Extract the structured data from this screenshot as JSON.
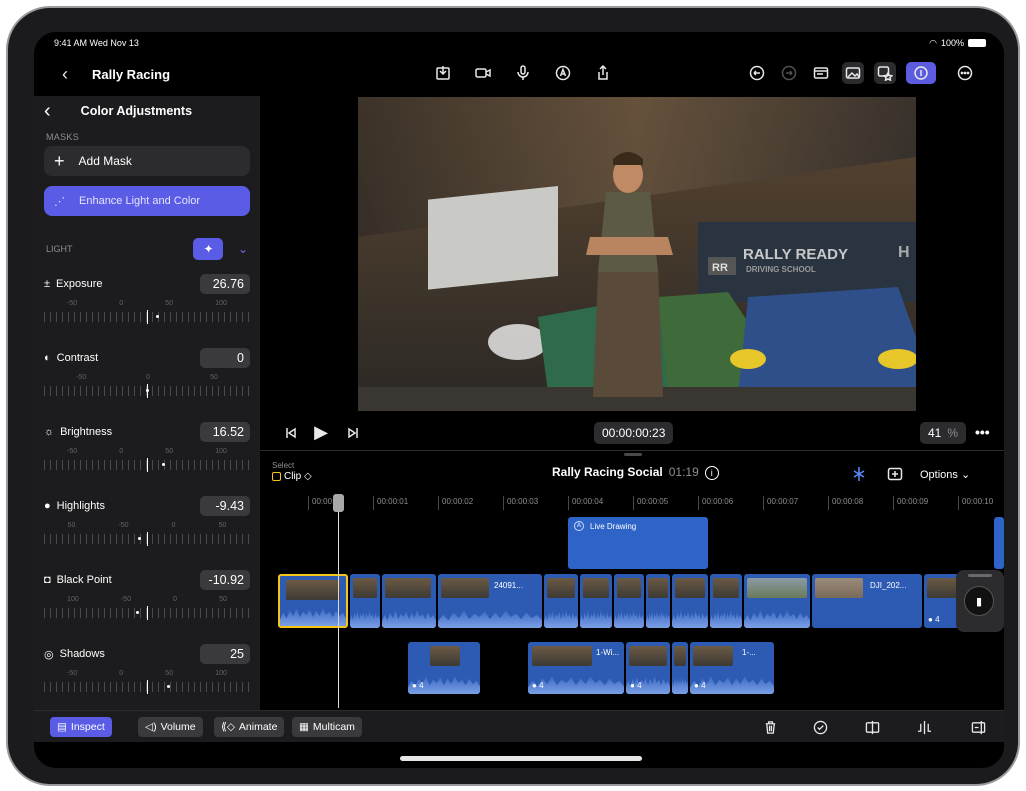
{
  "status": {
    "time_date": "9:41 AM  Wed Nov 13",
    "battery": "100%"
  },
  "topbar": {
    "back_label": "<",
    "title": "Rally Racing"
  },
  "inspector": {
    "title": "Color Adjustments",
    "masks_label": "MASKS",
    "add_mask_label": "Add Mask",
    "enhance_label": "Enhance Light and Color",
    "light_label": "LIGHT",
    "params": [
      {
        "name": "Exposure",
        "icon": "±",
        "value": "26.76",
        "ticks": [
          "-50",
          "0",
          "50",
          "100"
        ],
        "fraction": 0.55
      },
      {
        "name": "Contrast",
        "icon": "◐",
        "value": "0",
        "ticks": [
          "-50",
          "0",
          "50"
        ],
        "fraction": 0.5
      },
      {
        "name": "Brightness",
        "icon": "☼",
        "value": "16.52",
        "ticks": [
          "-50",
          "0",
          "50",
          "100"
        ],
        "fraction": 0.58
      },
      {
        "name": "Highlights",
        "icon": "●",
        "value": "-9.43",
        "ticks": [
          "50",
          "-50",
          "0",
          "50"
        ],
        "fraction": 0.46
      },
      {
        "name": "Black Point",
        "icon": "◘",
        "value": "-10.92",
        "ticks": [
          "100",
          "-50",
          "0",
          "50"
        ],
        "fraction": 0.45
      },
      {
        "name": "Shadows",
        "icon": "◎",
        "value": "25",
        "ticks": [
          "-50",
          "0",
          "50",
          "100"
        ],
        "fraction": 0.6
      }
    ]
  },
  "viewer": {
    "sign_text": "RALLY READY",
    "sign_subtext": "DRIVING SCHOOL",
    "sign_logo": "RR",
    "sign_letter": "H"
  },
  "player": {
    "timecode": "00:00:00:23",
    "zoom_value": "41",
    "zoom_unit": "%"
  },
  "timeline": {
    "select_label": "Select",
    "clip_mode": "Clip ◇",
    "project_name": "Rally Racing Social",
    "duration": "01:19",
    "options_label": "Options",
    "ruler": [
      "00:00:00",
      "00:00:01",
      "00:00:02",
      "00:00:03",
      "00:00:04",
      "00:00:05",
      "00:00:06",
      "00:00:07",
      "00:00:08",
      "00:00:09",
      "00:00:10",
      "00:0"
    ],
    "title_clip": "Live Drawing",
    "clip_24091": "24091...",
    "clip_dji": "DJI_202...",
    "conn_a_badge": "4",
    "conn_b_label": "1-Wi...",
    "conn_b_badge": "4",
    "conn_c_badge": "4",
    "conn_d_label": "1-...",
    "conn_d_badge": "4",
    "main_end_badge": "4"
  },
  "bottombar": {
    "inspect_label": "Inspect",
    "volume_label": "Volume",
    "animate_label": "Animate",
    "multicam_label": "Multicam"
  },
  "colors": {
    "accent": "#5a5ce6",
    "clip_blue": "#2d5bb4",
    "selected_yellow": "#f5c518"
  }
}
